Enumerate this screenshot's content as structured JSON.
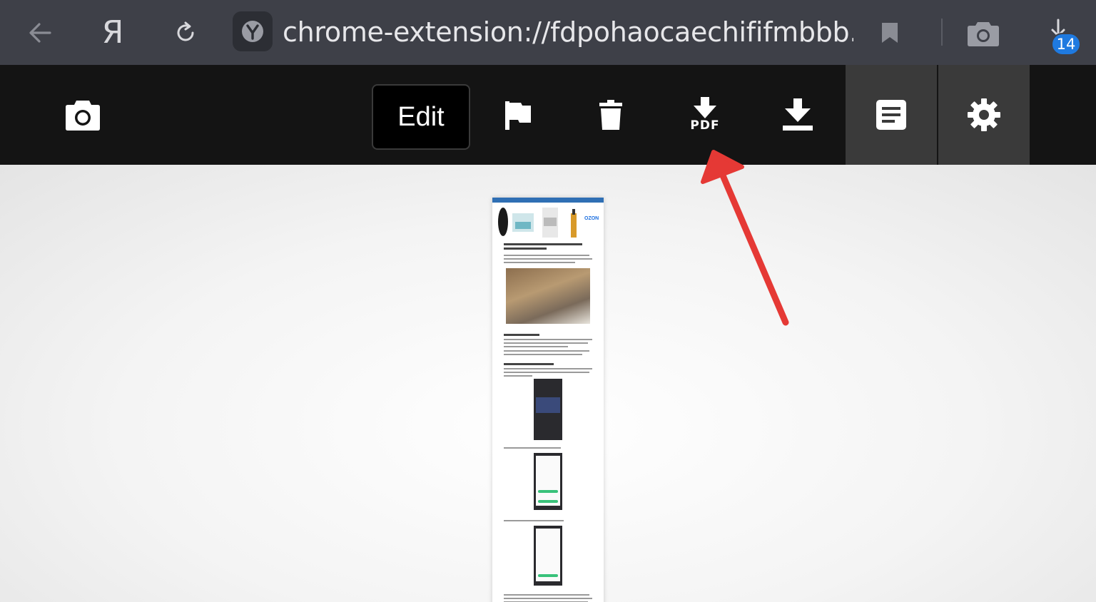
{
  "browser": {
    "yandex_glyph": "Я",
    "url": "chrome-extension://fdpohaocaechififmbbb...",
    "downloads_count": "14"
  },
  "toolbar": {
    "edit_label": "Edit",
    "pdf_label": "PDF"
  },
  "preview": {
    "ozon_label": "OZON"
  },
  "colors": {
    "address_bar": "#3e4048",
    "toolbar": "#141414",
    "active_tab": "#3a3a3a",
    "badge": "#1f7ae0",
    "annotation_arrow": "#e53935"
  },
  "icons": [
    "back-arrow-icon",
    "yandex-icon",
    "reload-icon",
    "yandex-shield-icon",
    "bookmark-icon",
    "camera-icon",
    "download-icon",
    "camera-icon",
    "flag-icon",
    "trash-icon",
    "download-pdf-icon",
    "download-icon",
    "document-icon",
    "gear-icon"
  ]
}
